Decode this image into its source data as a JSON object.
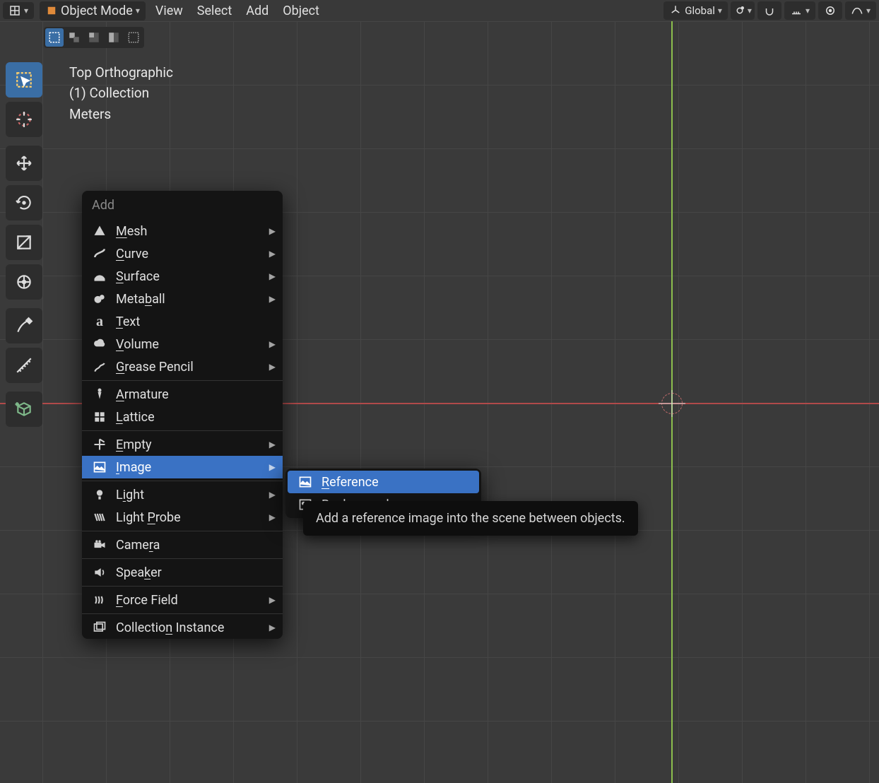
{
  "header": {
    "mode_label": "Object Mode",
    "menu_view": "View",
    "menu_select": "Select",
    "menu_add": "Add",
    "menu_object": "Object",
    "orientation_label": "Global"
  },
  "overlay": {
    "line1": "Top Orthographic",
    "line2": "(1) Collection",
    "line3": "Meters"
  },
  "add_menu": {
    "title": "Add",
    "items": {
      "mesh": "Mesh",
      "curve": "Curve",
      "surface": "Surface",
      "metaball": "Metaball",
      "text": "Text",
      "volume": "Volume",
      "grease": "Grease Pencil",
      "armature": "Armature",
      "lattice": "Lattice",
      "empty": "Empty",
      "image": "Image",
      "light": "Light",
      "lightprobe": "Light Probe",
      "camera": "Camera",
      "speaker": "Speaker",
      "forcefield": "Force Field",
      "collection": "Collection Instance"
    }
  },
  "submenu": {
    "reference": "Reference",
    "background": "Background"
  },
  "tooltip": "Add a reference image into the scene between objects."
}
